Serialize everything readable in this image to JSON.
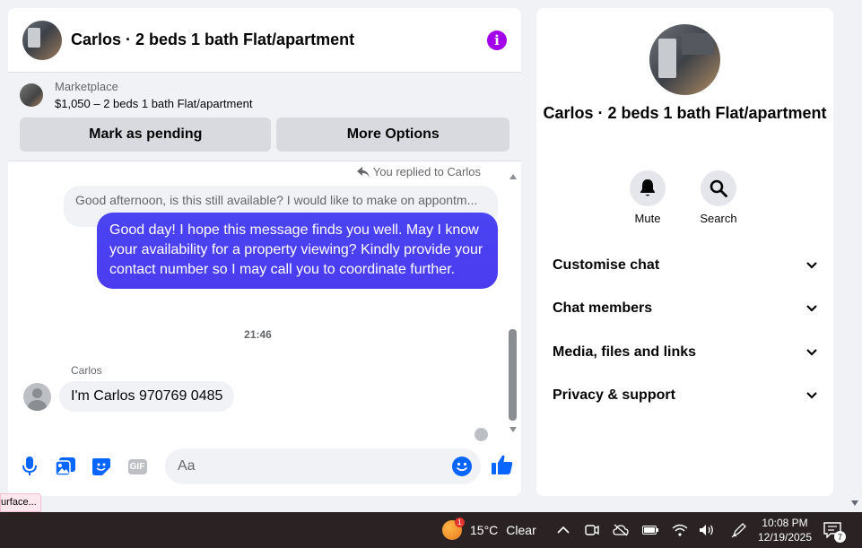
{
  "chat": {
    "title": "Carlos · 2 beds 1 bath Flat/apartment",
    "info_icon": "info-icon",
    "marketplace": {
      "label": "Marketplace",
      "listing": "$1,050 – 2 beds 1 bath Flat/apartment",
      "pending_label": "Mark as pending",
      "more_label": "More Options"
    },
    "messages": {
      "replied_label": "You replied to Carlos",
      "quoted": "Good afternoon, is this still available? I would like to make on appontm...",
      "outgoing": "Good day! I hope this message finds you well. May I know your availability for a property viewing? Kindly provide your contact number so I may call you to coordinate further.",
      "time": "21:46",
      "sender": "Carlos",
      "incoming": "I'm Carlos 970769 0485"
    },
    "composer": {
      "placeholder": "Aa"
    },
    "accent_color": "#4b3ff5"
  },
  "info_panel": {
    "title": "Carlos · 2 beds 1 bath Flat/apartment",
    "actions": [
      {
        "label": "Mute",
        "icon": "bell-icon"
      },
      {
        "label": "Search",
        "icon": "search-icon"
      }
    ],
    "sections": [
      "Customise chat",
      "Chat members",
      "Media, files and links",
      "Privacy & support"
    ]
  },
  "tooltip": "urface...",
  "taskbar": {
    "weather_temp": "15°C",
    "weather_desc": "Clear",
    "weather_badge": "1",
    "time": "10:08 PM",
    "date": "12/19/2025",
    "notification_count": "7"
  }
}
